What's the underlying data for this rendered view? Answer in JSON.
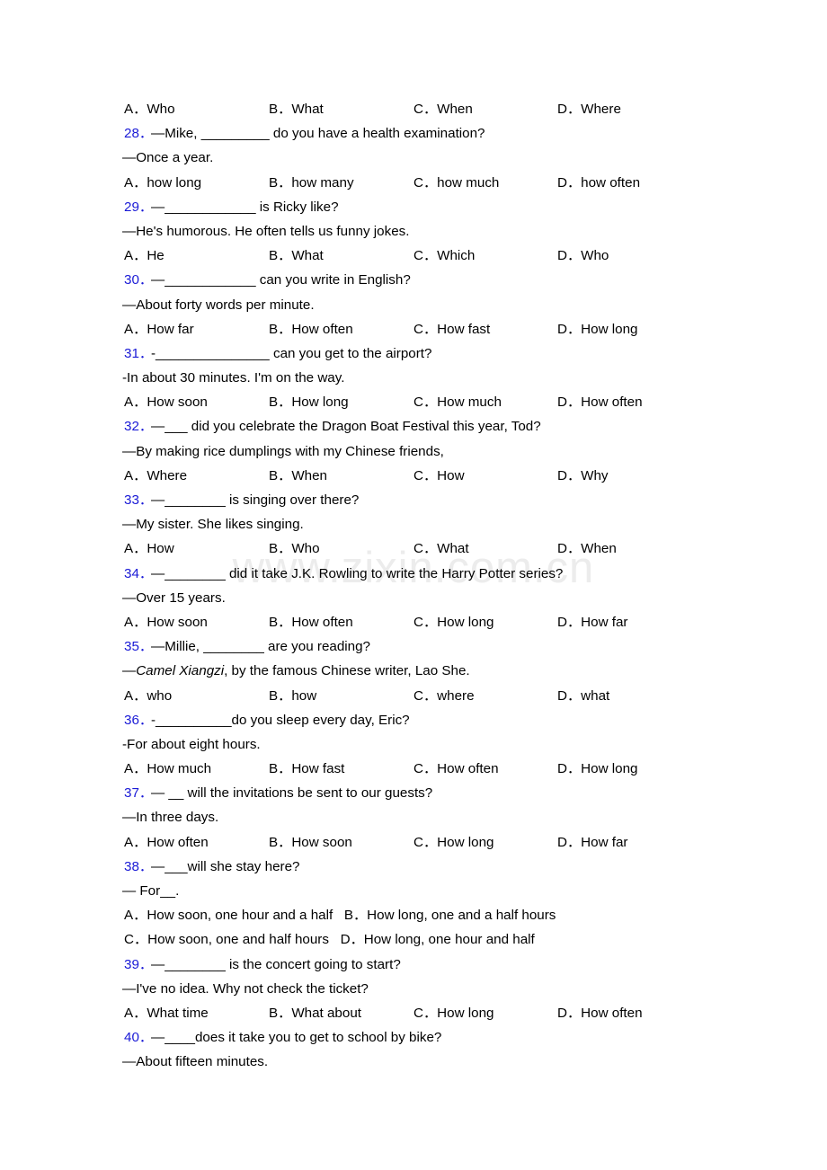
{
  "watermark": {
    "text": "www.zixin.com.cn",
    "color": "#ececec"
  },
  "accent": {
    "number_color": "#1a1ad6"
  },
  "top_options": {
    "a": "A．Who",
    "b": "B．What",
    "c": "C．When",
    "d": "D．Where"
  },
  "questions": [
    {
      "number": "28．",
      "stem": "—Mike, _________ do you have a health examination?",
      "reply": "—Once a year.",
      "options": {
        "a": "A．how long",
        "b": "B．how many",
        "c": "C．how much",
        "d": "D．how often"
      }
    },
    {
      "number": "29．",
      "stem": "—____________ is Ricky like?",
      "reply": "—He's humorous. He often tells us funny jokes.",
      "options": {
        "a": "A．He",
        "b": "B．What",
        "c": "C．Which",
        "d": "D．Who"
      }
    },
    {
      "number": "30．",
      "stem": "—____________ can you write in English?",
      "reply": "—About forty words per minute.",
      "options": {
        "a": "A．How far",
        "b": "B．How often",
        "c": "C．How fast",
        "d": "D．How long"
      }
    },
    {
      "number": "31．",
      "stem": "-_______________ can you get to the airport?",
      "reply": "-In about 30 minutes. I'm on the way.",
      "options": {
        "a": "A．How soon",
        "b": "B．How long",
        "c": "C．How much",
        "d": "D．How often"
      }
    },
    {
      "number": "32．",
      "stem": "—___ did you celebrate the Dragon Boat Festival this year, Tod?",
      "reply": "—By making rice dumplings with my Chinese friends,",
      "options": {
        "a": "A．Where",
        "b": "B．When",
        "c": "C．How",
        "d": "D．Why"
      }
    },
    {
      "number": "33．",
      "stem": "—________ is singing over there?",
      "reply": "—My sister. She likes singing.",
      "options": {
        "a": "A．How",
        "b": "B．Who",
        "c": "C．What",
        "d": "D．When"
      }
    },
    {
      "number": "34．",
      "stem": "—________ did it take J.K. Rowling to write the Harry Potter series?",
      "reply": "—Over 15 years.",
      "options": {
        "a": "A．How soon",
        "b": "B．How often",
        "c": "C．How long",
        "d": "D．How far"
      }
    },
    {
      "number": "35．",
      "stem": "—Millie, ________ are you reading?",
      "reply_pre": "—",
      "reply_italic": "Camel Xiangzi",
      "reply_post": ", by the famous Chinese writer, Lao She.",
      "options": {
        "a": "A．who",
        "b": "B．how",
        "c": "C．where",
        "d": "D．what"
      }
    },
    {
      "number": "36．",
      "stem": "-__________do you sleep every day, Eric?",
      "reply": "-For about eight hours.",
      "options": {
        "a": "A．How much",
        "b": "B．How fast",
        "c": "C．How often",
        "d": "D．How long"
      }
    },
    {
      "number": "37．",
      "stem": "— __ will the invitations be sent to our guests?",
      "reply": "—In three days.",
      "options": {
        "a": "A．How often",
        "b": "B．How soon",
        "c": "C．How long",
        "d": "D．How far"
      }
    },
    {
      "number": "38．",
      "stem": "—___will she stay here?",
      "reply": "— For__.",
      "options_flow_row1": "A．How soon, one hour and a half   B．How long, one and a half hours",
      "options_flow_row2": "C．How soon, one and half hours   D．How long, one hour and half"
    },
    {
      "number": "39．",
      "stem": "—________ is the concert going to start?",
      "reply": "—I've no idea. Why not check the ticket?",
      "options": {
        "a": "A．What time",
        "b": "B．What about",
        "c": "C．How long",
        "d": "D．How often"
      }
    },
    {
      "number": "40．",
      "stem": "—____does it take you to get to school by bike?",
      "reply": "—About fifteen minutes."
    }
  ]
}
